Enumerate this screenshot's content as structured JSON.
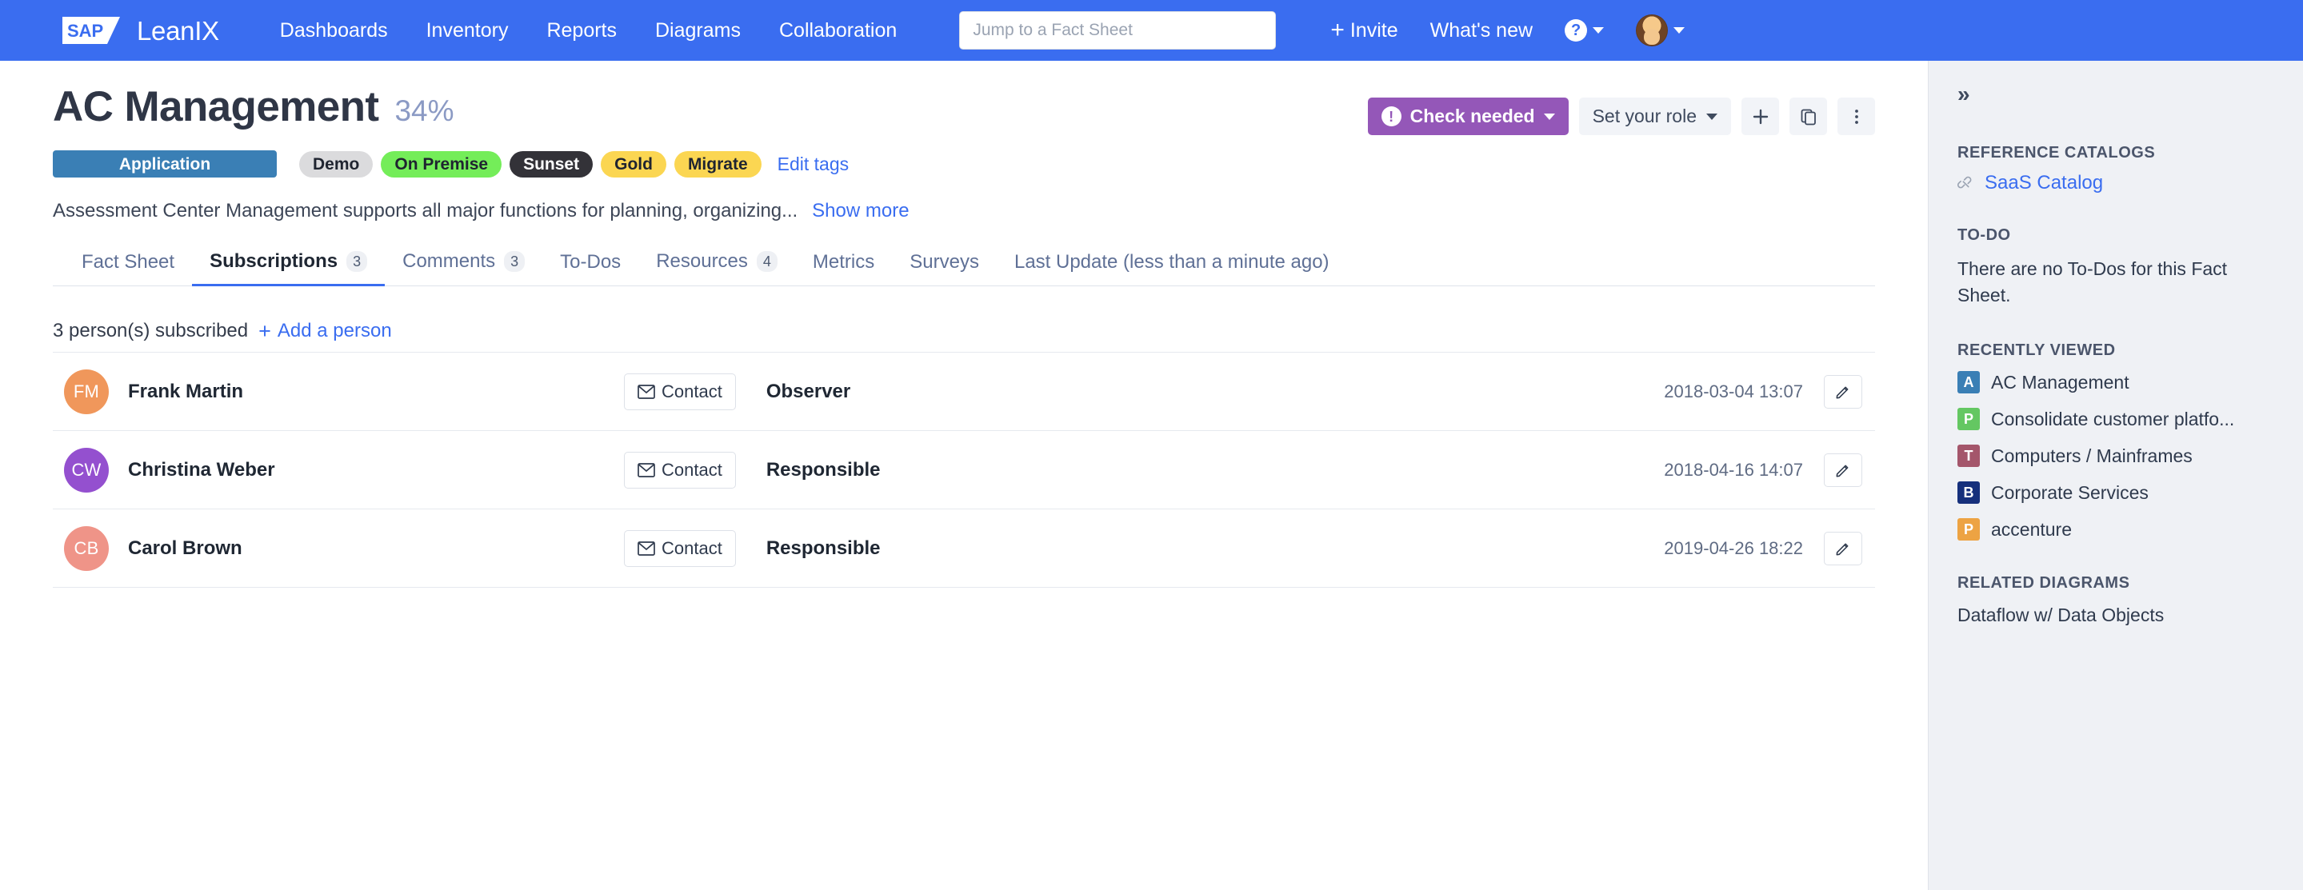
{
  "topnav": {
    "brand": {
      "mark": "SAP",
      "name": "LeanIX"
    },
    "links": [
      {
        "label": "Dashboards"
      },
      {
        "label": "Inventory"
      },
      {
        "label": "Reports"
      },
      {
        "label": "Diagrams"
      },
      {
        "label": "Collaboration"
      }
    ],
    "search": {
      "placeholder": "Jump to a Fact Sheet",
      "value": ""
    },
    "invite_label": "Invite",
    "whats_new_label": "What's new",
    "help_glyph": "?",
    "accent_color": "#3a6df0"
  },
  "header": {
    "title": "AC Management",
    "completion": "34%",
    "check_needed_label": "Check needed",
    "check_needed_color": "#9457b8",
    "set_role_label": "Set your role",
    "tags": [
      {
        "label": "Application",
        "kind": "type",
        "bg": "#3a7fb5",
        "fg": "#ffffff"
      },
      {
        "label": "Demo",
        "kind": "demo",
        "bg": "#dbdbdd",
        "fg": "#1f2430"
      },
      {
        "label": "On Premise",
        "kind": "onprem",
        "bg": "#74ed59",
        "fg": "#1f2430"
      },
      {
        "label": "Sunset",
        "kind": "sunset",
        "bg": "#333238",
        "fg": "#ffffff"
      },
      {
        "label": "Gold",
        "kind": "gold",
        "bg": "#fbd652",
        "fg": "#1f2430"
      },
      {
        "label": "Migrate",
        "kind": "migrate",
        "bg": "#fbd652",
        "fg": "#1f2430"
      }
    ],
    "edit_tags_label": "Edit tags",
    "description": "Assessment Center Management supports all major functions for planning, organizing...",
    "show_more_label": "Show more"
  },
  "tabs": [
    {
      "label": "Fact Sheet",
      "count": null,
      "active": false
    },
    {
      "label": "Subscriptions",
      "count": "3",
      "active": true
    },
    {
      "label": "Comments",
      "count": "3",
      "active": false
    },
    {
      "label": "To-Dos",
      "count": null,
      "active": false
    },
    {
      "label": "Resources",
      "count": "4",
      "active": false
    },
    {
      "label": "Metrics",
      "count": null,
      "active": false
    },
    {
      "label": "Surveys",
      "count": null,
      "active": false
    },
    {
      "label": "Last Update (less than a minute ago)",
      "count": null,
      "active": false
    }
  ],
  "subscriptions": {
    "summary": "3 person(s) subscribed",
    "add_label": "Add a person",
    "contact_label": "Contact",
    "rows": [
      {
        "initials": "FM",
        "avatar_color": "#f0975b",
        "name": "Frank Martin",
        "role": "Observer",
        "date": "2018-03-04 13:07"
      },
      {
        "initials": "CW",
        "avatar_color": "#9450cf",
        "name": "Christina Weber",
        "role": "Responsible",
        "date": "2018-04-16 14:07"
      },
      {
        "initials": "CB",
        "avatar_color": "#ef9488",
        "name": "Carol Brown",
        "role": "Responsible",
        "date": "2019-04-26 18:22"
      }
    ]
  },
  "right_panel": {
    "expand_glyph": "»",
    "reference_catalogs": {
      "title": "REFERENCE CATALOGS",
      "items": [
        {
          "label": "SaaS Catalog",
          "icon": "broken-link-icon"
        }
      ]
    },
    "todo": {
      "title": "TO-DO",
      "text": "There are no To-Dos for this Fact Sheet."
    },
    "recently_viewed": {
      "title": "RECENTLY VIEWED",
      "items": [
        {
          "badge": "A",
          "color": "#3a7fb5",
          "label": "AC Management"
        },
        {
          "badge": "P",
          "color": "#64c濃",
          "label": "Consolidate customer platfo..."
        },
        {
          "badge": "T",
          "color": "#a4566b",
          "label": "Computers / Mainframes"
        },
        {
          "badge": "B",
          "color": "#16307c",
          "label": "Corporate Services"
        },
        {
          "badge": "P",
          "color": "#eda343",
          "label": "accenture"
        }
      ]
    },
    "related_diagrams": {
      "title": "RELATED DIAGRAMS",
      "items": [
        {
          "label": "Dataflow w/ Data Objects"
        }
      ]
    }
  }
}
